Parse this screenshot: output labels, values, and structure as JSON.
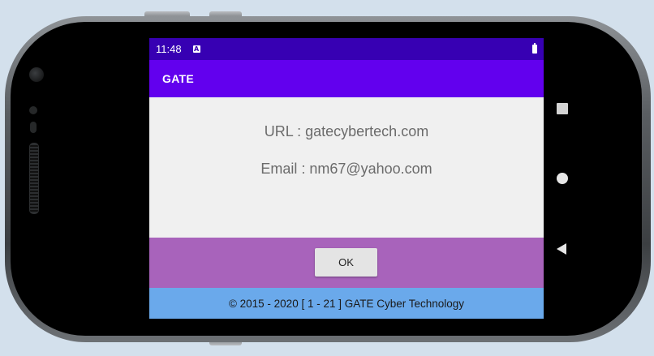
{
  "status_bar": {
    "time": "11:48",
    "notification_icon": "A"
  },
  "app_bar": {
    "title": "GATE"
  },
  "dialog": {
    "url_line": "URL : gatecybertech.com",
    "email_line": "Email : nm67@yahoo.com",
    "ok_label": "OK"
  },
  "footer": {
    "text": "© 2015 - 2020 [ 1 - 21 ]   GATE Cyber Technology"
  },
  "nav_buttons": [
    "recents-icon",
    "home-icon",
    "back-icon"
  ],
  "colors": {
    "status_bar": "#3700b3",
    "app_bar": "#6200ee",
    "action_area": "#a863bb",
    "footer": "#6aa9eb"
  }
}
